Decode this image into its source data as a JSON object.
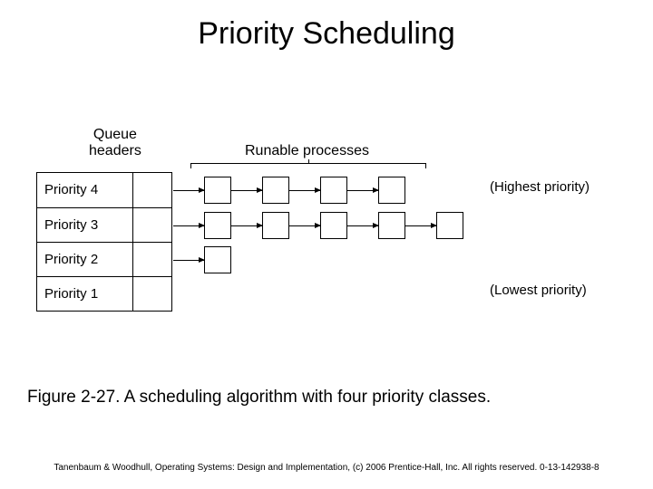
{
  "title": "Priority Scheduling",
  "labels": {
    "queue_headers": "Queue\nheaders",
    "runable": "Runable processes"
  },
  "rows": [
    {
      "label": "Priority 4",
      "procs": 4,
      "annotation": "(Highest priority)"
    },
    {
      "label": "Priority 3",
      "procs": 5,
      "annotation": ""
    },
    {
      "label": "Priority 2",
      "procs": 1,
      "annotation": ""
    },
    {
      "label": "Priority 1",
      "procs": 0,
      "annotation": "(Lowest priority)"
    }
  ],
  "caption": "Figure 2-27. A scheduling algorithm with four priority classes.",
  "footer": "Tanenbaum & Woodhull, Operating Systems: Design and Implementation, (c) 2006 Prentice-Hall, Inc. All rights reserved. 0-13-142938-8"
}
